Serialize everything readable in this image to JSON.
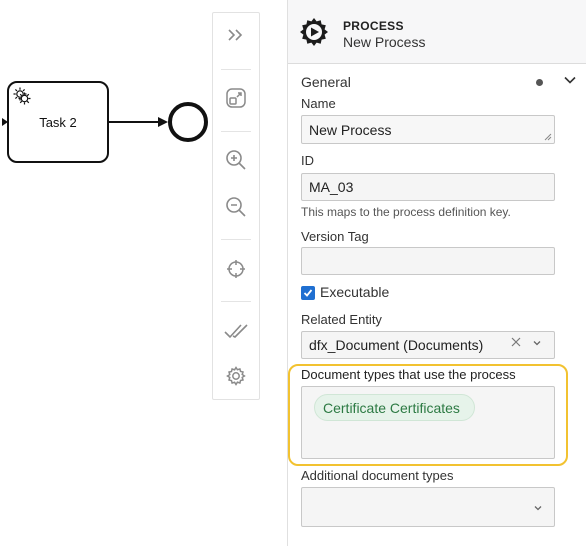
{
  "canvas": {
    "task_label": "Task 2"
  },
  "toolbar": {
    "buttons": [
      {
        "icon": "double-chevron-right-icon"
      },
      {
        "icon": "fit-viewport-icon"
      },
      {
        "icon": "zoom-in-icon"
      },
      {
        "icon": "zoom-out-icon"
      },
      {
        "icon": "crosshair-icon"
      },
      {
        "icon": "double-check-icon"
      },
      {
        "icon": "gear-icon"
      }
    ]
  },
  "panel": {
    "header": {
      "type": "PROCESS",
      "name": "New Process",
      "icon": "process-gear-icon"
    },
    "group": {
      "title": "General"
    },
    "fields": {
      "name_label": "Name",
      "name_value": "New Process",
      "id_label": "ID",
      "id_value": "MA_03",
      "id_hint": "This maps to the process definition key.",
      "version_tag_label": "Version Tag",
      "version_tag_value": "",
      "executable_label": "Executable",
      "executable_checked": true,
      "related_entity_label": "Related Entity",
      "related_entity_value": "dfx_Document (Documents)",
      "doc_types_label": "Document types that use the process",
      "doc_types_tags": [
        "Certificate Certificates"
      ],
      "additional_doc_types_label": "Additional document types",
      "additional_doc_types_value": ""
    },
    "colors": {
      "highlight": "#f2c230",
      "checkbox": "#1f6fd1",
      "tag_text": "#2c7a43",
      "tag_bg": "#e6f3ea"
    }
  }
}
